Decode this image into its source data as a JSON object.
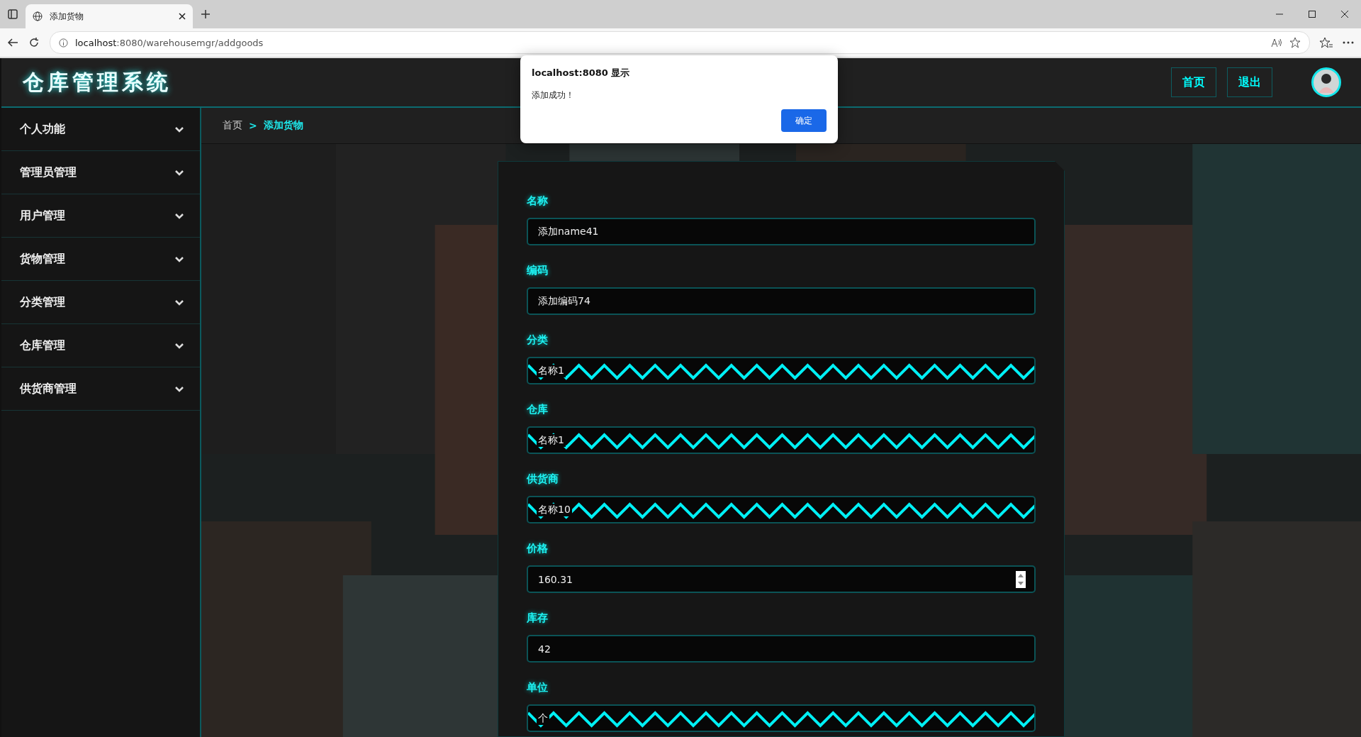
{
  "browser": {
    "tab_title": "添加货物",
    "url_host": "localhost",
    "url_rest": ":8080/warehousemgr/addgoods"
  },
  "header": {
    "title": "仓库管理系统",
    "nav": [
      {
        "label": "首页"
      },
      {
        "label": "退出"
      }
    ]
  },
  "dialog": {
    "title": "localhost:8080 显示",
    "message": "添加成功！",
    "button": "确定"
  },
  "sidebar": {
    "items": [
      {
        "label": "个人功能",
        "expanded": false
      },
      {
        "label": "管理员管理",
        "expanded": false
      },
      {
        "label": "用户管理",
        "expanded": false
      },
      {
        "label": "货物管理",
        "expanded": false
      },
      {
        "label": "分类管理",
        "expanded": false
      },
      {
        "label": "仓库管理",
        "expanded": false
      },
      {
        "label": "供货商管理",
        "expanded": false
      }
    ]
  },
  "breadcrumb": [
    {
      "label": "首页",
      "selected": false
    },
    {
      "label": "添加货物",
      "selected": true
    }
  ],
  "breadcrumb_separator": ">",
  "form": {
    "fields": [
      {
        "label": "名称",
        "kind": "text",
        "value": "添加name41"
      },
      {
        "label": "编码",
        "kind": "text",
        "value": "添加编码74"
      },
      {
        "label": "分类",
        "kind": "select",
        "value": "名称1"
      },
      {
        "label": "仓库",
        "kind": "select",
        "value": "名称1"
      },
      {
        "label": "供货商",
        "kind": "select",
        "value": "名称10"
      },
      {
        "label": "价格",
        "kind": "number",
        "value": "160.31"
      },
      {
        "label": "库存",
        "kind": "text",
        "value": "42"
      },
      {
        "label": "单位",
        "kind": "select",
        "value": "个"
      }
    ]
  }
}
